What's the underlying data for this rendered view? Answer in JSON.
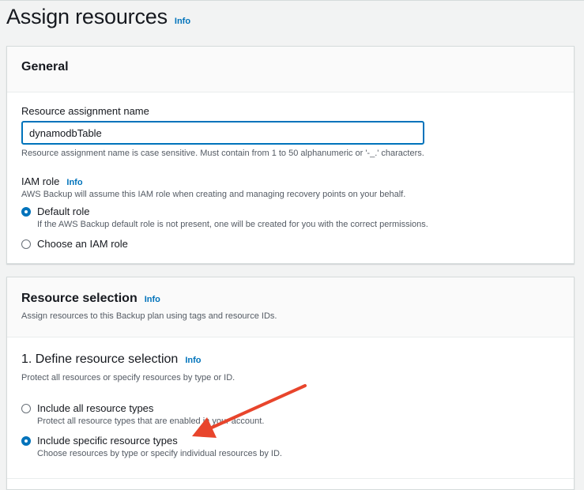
{
  "page": {
    "title": "Assign resources",
    "info_label": "Info"
  },
  "general": {
    "title": "General",
    "assignment_name_label": "Resource assignment name",
    "assignment_name_value": "dynamodbTable",
    "assignment_name_hint": "Resource assignment name is case sensitive. Must contain from 1 to 50 alphanumeric or '-_.' characters.",
    "iam_role_label": "IAM role",
    "iam_role_info": "Info",
    "iam_role_desc": "AWS Backup will assume this IAM role when creating and managing recovery points on your behalf.",
    "options": [
      {
        "label": "Default role",
        "desc": "If the AWS Backup default role is not present, one will be created for you with the correct permissions.",
        "checked": true
      },
      {
        "label": "Choose an IAM role",
        "desc": "",
        "checked": false
      }
    ]
  },
  "resource_selection": {
    "title": "Resource selection",
    "info_label": "Info",
    "desc": "Assign resources to this Backup plan using tags and resource IDs.",
    "define": {
      "title": "1. Define resource selection",
      "info_label": "Info",
      "desc": "Protect all resources or specify resources by type or ID.",
      "options": [
        {
          "label": "Include all resource types",
          "desc": "Protect all resource types that are enabled in your account.",
          "checked": false
        },
        {
          "label": "Include specific resource types",
          "desc": "Choose resources by type or specify individual resources by ID.",
          "checked": true
        }
      ]
    }
  },
  "colors": {
    "accent": "#0073bb",
    "annotation_arrow": "#e8452c",
    "background": "#f2f3f3"
  }
}
